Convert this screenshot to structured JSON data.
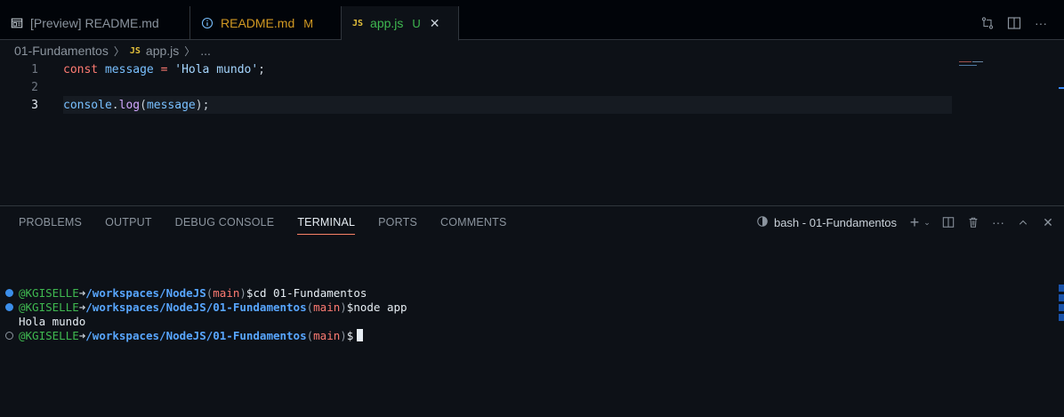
{
  "tabs": [
    {
      "label": "[Preview] README.md",
      "icon": "preview-icon",
      "modified": ""
    },
    {
      "label": "README.md",
      "icon": "info-icon",
      "modified": "M"
    },
    {
      "label": "app.js",
      "icon": "js-file-icon",
      "badge": "JS",
      "modified": "U",
      "active": true
    }
  ],
  "tab_actions": [
    "compare-changes-icon",
    "split-editor-icon",
    "more-icon"
  ],
  "breadcrumb": {
    "folder": "01-Fundamentos",
    "file_badge": "JS",
    "file": "app.js",
    "trail": "..."
  },
  "editor": {
    "current_line": 3,
    "lines": [
      {
        "num": "1",
        "tokens": [
          "const",
          "message",
          "=",
          "'Hola mundo'",
          ";"
        ]
      },
      {
        "num": "2",
        "tokens": []
      },
      {
        "num": "3",
        "tokens": [
          "console",
          ".",
          "log",
          "(",
          "message",
          ")",
          ";"
        ]
      }
    ]
  },
  "panel": {
    "tabs": [
      "PROBLEMS",
      "OUTPUT",
      "DEBUG CONSOLE",
      "TERMINAL",
      "PORTS",
      "COMMENTS"
    ],
    "active_tab": "TERMINAL",
    "shell_label": "bash - 01-Fundamentos",
    "actions": [
      "add-terminal-icon",
      "chevron-down-icon",
      "split-terminal-icon",
      "trash-icon",
      "more-icon",
      "maximize-icon",
      "close-icon"
    ]
  },
  "terminal": {
    "lines": [
      {
        "user": "@KGISELLE",
        "arrow": "➜",
        "path": "/workspaces/NodeJS",
        "branch": "main",
        "prompt": "$",
        "cmd": "cd 01-Fundamentos"
      },
      {
        "user": "@KGISELLE",
        "arrow": "➜",
        "path": "/workspaces/NodeJS/01-Fundamentos",
        "branch": "main",
        "prompt": "$",
        "cmd": "node app"
      },
      {
        "output": "Hola mundo"
      },
      {
        "user": "@KGISELLE",
        "arrow": "➜",
        "path": "/workspaces/NodeJS/01-Fundamentos",
        "branch": "main",
        "prompt": "$",
        "cmd": ""
      }
    ]
  },
  "colors": {
    "background": "#0d1117",
    "keyword": "#ff7b72",
    "variable": "#79c0ff",
    "string": "#a5d6ff",
    "function": "#d2a8ff",
    "git_modified": "#d29922",
    "git_untracked": "#3fb950",
    "active_tab_underline": "#f78166"
  }
}
